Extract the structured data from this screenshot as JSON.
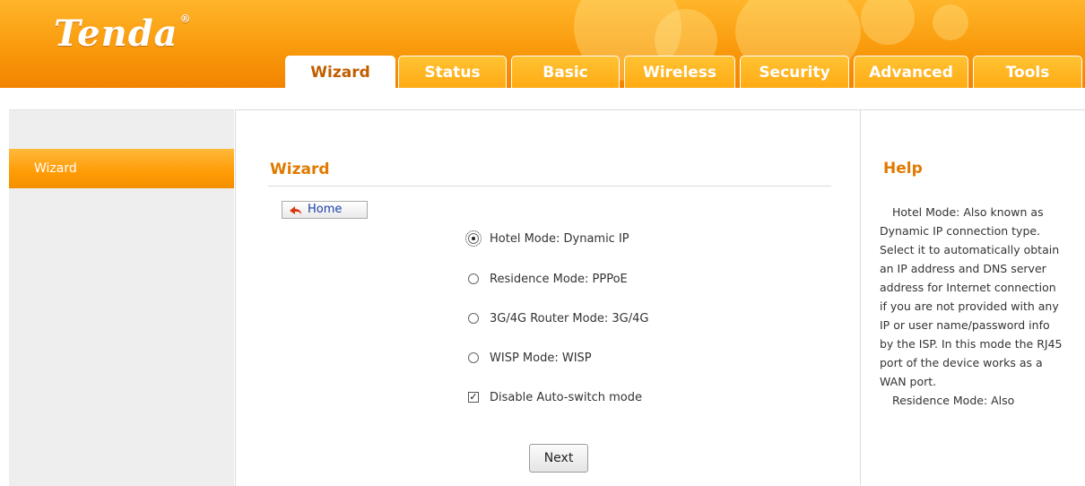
{
  "brand": {
    "logo_text": "Tenda",
    "logo_mark": "®"
  },
  "nav": {
    "tabs": [
      {
        "label": "Wizard",
        "active": true
      },
      {
        "label": "Status",
        "active": false
      },
      {
        "label": "Basic",
        "active": false
      },
      {
        "label": "Wireless",
        "active": false
      },
      {
        "label": "Security",
        "active": false
      },
      {
        "label": "Advanced",
        "active": false
      },
      {
        "label": "Tools",
        "active": false
      }
    ]
  },
  "sidebar": {
    "items": [
      {
        "label": "Wizard",
        "selected": true
      }
    ]
  },
  "main": {
    "title": "Wizard",
    "home_label": "Home",
    "options": [
      {
        "label": "Hotel Mode: Dynamic IP",
        "selected": true
      },
      {
        "label": "Residence Mode: PPPoE",
        "selected": false
      },
      {
        "label": "3G/4G Router Mode: 3G/4G",
        "selected": false
      },
      {
        "label": "WISP Mode: WISP",
        "selected": false
      }
    ],
    "checkbox": {
      "label": "Disable Auto-switch mode",
      "checked": true
    },
    "next_label": "Next"
  },
  "help": {
    "title": "Help",
    "paragraphs": [
      "Hotel Mode: Also known as Dynamic IP connection type. Select it to automatically obtain an IP address and DNS server address for Internet connection if you are not provided with any IP or user name/password info by the ISP. In this mode the RJ45 port of the device works as a WAN port.",
      "Residence Mode: Also"
    ]
  },
  "colors": {
    "brand_orange": "#f99a0c",
    "title_orange": "#e07a00",
    "link_blue": "#1a3fa8"
  }
}
